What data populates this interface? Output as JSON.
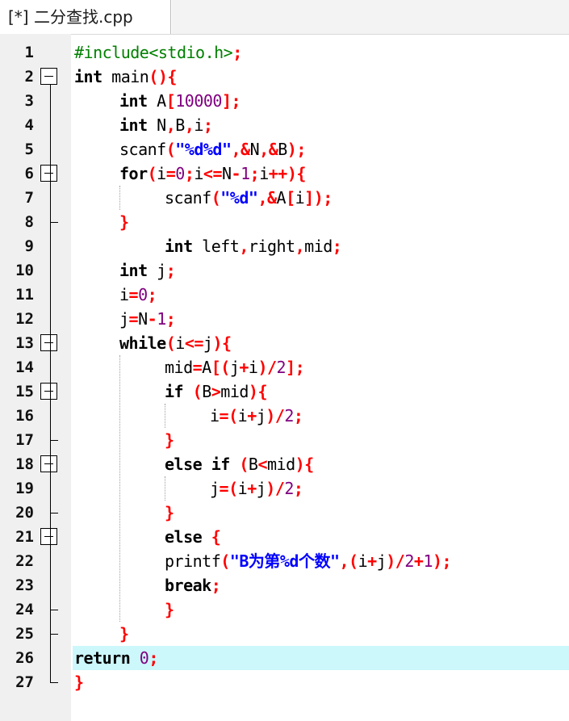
{
  "tab": {
    "title": "[*] 二分查找.cpp"
  },
  "lines": [
    {
      "n": "1",
      "indent": 0,
      "tokens": [
        [
          "pre",
          "#include<stdio.h>"
        ],
        [
          "sym",
          ";"
        ]
      ]
    },
    {
      "n": "2",
      "indent": 0,
      "tokens": [
        [
          "kw",
          "int"
        ],
        [
          "plain",
          " main"
        ],
        [
          "sym",
          "(){"
        ]
      ]
    },
    {
      "n": "3",
      "indent": 1,
      "tokens": [
        [
          "kw",
          "int"
        ],
        [
          "plain",
          " A"
        ],
        [
          "sym",
          "["
        ],
        [
          "num",
          "10000"
        ],
        [
          "sym",
          "];"
        ]
      ]
    },
    {
      "n": "4",
      "indent": 1,
      "tokens": [
        [
          "kw",
          "int"
        ],
        [
          "plain",
          " N"
        ],
        [
          "sym",
          ","
        ],
        [
          "plain",
          "B"
        ],
        [
          "sym",
          ","
        ],
        [
          "plain",
          "i"
        ],
        [
          "sym",
          ";"
        ]
      ]
    },
    {
      "n": "5",
      "indent": 1,
      "tokens": [
        [
          "plain",
          "scanf"
        ],
        [
          "sym",
          "("
        ],
        [
          "str",
          "\"%d%d\""
        ],
        [
          "sym",
          ",&"
        ],
        [
          "plain",
          "N"
        ],
        [
          "sym",
          ",&"
        ],
        [
          "plain",
          "B"
        ],
        [
          "sym",
          ");"
        ]
      ]
    },
    {
      "n": "6",
      "indent": 1,
      "tokens": [
        [
          "kw",
          "for"
        ],
        [
          "sym",
          "("
        ],
        [
          "plain",
          "i"
        ],
        [
          "sym",
          "="
        ],
        [
          "num",
          "0"
        ],
        [
          "sym",
          ";"
        ],
        [
          "plain",
          "i"
        ],
        [
          "sym",
          "<="
        ],
        [
          "plain",
          "N"
        ],
        [
          "sym",
          "-"
        ],
        [
          "num",
          "1"
        ],
        [
          "sym",
          ";"
        ],
        [
          "plain",
          "i"
        ],
        [
          "sym",
          "++){"
        ]
      ]
    },
    {
      "n": "7",
      "indent": 2,
      "tokens": [
        [
          "plain",
          "scanf"
        ],
        [
          "sym",
          "("
        ],
        [
          "str",
          "\"%d\""
        ],
        [
          "sym",
          ",&"
        ],
        [
          "plain",
          "A"
        ],
        [
          "sym",
          "["
        ],
        [
          "plain",
          "i"
        ],
        [
          "sym",
          "]);"
        ]
      ]
    },
    {
      "n": "8",
      "indent": 1,
      "tokens": [
        [
          "sym",
          "}"
        ]
      ]
    },
    {
      "n": "9",
      "indent": 2,
      "tokens": [
        [
          "kw",
          "int"
        ],
        [
          "plain",
          " left"
        ],
        [
          "sym",
          ","
        ],
        [
          "plain",
          "right"
        ],
        [
          "sym",
          ","
        ],
        [
          "plain",
          "mid"
        ],
        [
          "sym",
          ";"
        ]
      ]
    },
    {
      "n": "10",
      "indent": 1,
      "tokens": [
        [
          "kw",
          "int"
        ],
        [
          "plain",
          " j"
        ],
        [
          "sym",
          ";"
        ]
      ]
    },
    {
      "n": "11",
      "indent": 1,
      "tokens": [
        [
          "plain",
          "i"
        ],
        [
          "sym",
          "="
        ],
        [
          "num",
          "0"
        ],
        [
          "sym",
          ";"
        ]
      ]
    },
    {
      "n": "12",
      "indent": 1,
      "tokens": [
        [
          "plain",
          "j"
        ],
        [
          "sym",
          "="
        ],
        [
          "plain",
          "N"
        ],
        [
          "sym",
          "-"
        ],
        [
          "num",
          "1"
        ],
        [
          "sym",
          ";"
        ]
      ]
    },
    {
      "n": "13",
      "indent": 1,
      "tokens": [
        [
          "kw",
          "while"
        ],
        [
          "sym",
          "("
        ],
        [
          "plain",
          "i"
        ],
        [
          "sym",
          "<="
        ],
        [
          "plain",
          "j"
        ],
        [
          "sym",
          "){"
        ]
      ]
    },
    {
      "n": "14",
      "indent": 2,
      "tokens": [
        [
          "plain",
          "mid"
        ],
        [
          "sym",
          "="
        ],
        [
          "plain",
          "A"
        ],
        [
          "sym",
          "[("
        ],
        [
          "plain",
          "j"
        ],
        [
          "sym",
          "+"
        ],
        [
          "plain",
          "i"
        ],
        [
          "sym",
          ")/"
        ],
        [
          "num",
          "2"
        ],
        [
          "sym",
          "];"
        ]
      ]
    },
    {
      "n": "15",
      "indent": 2,
      "tokens": [
        [
          "kw",
          "if"
        ],
        [
          "plain",
          " "
        ],
        [
          "sym",
          "("
        ],
        [
          "plain",
          "B"
        ],
        [
          "sym",
          ">"
        ],
        [
          "plain",
          "mid"
        ],
        [
          "sym",
          "){"
        ]
      ]
    },
    {
      "n": "16",
      "indent": 3,
      "tokens": [
        [
          "plain",
          "i"
        ],
        [
          "sym",
          "=("
        ],
        [
          "plain",
          "i"
        ],
        [
          "sym",
          "+"
        ],
        [
          "plain",
          "j"
        ],
        [
          "sym",
          ")/"
        ],
        [
          "num",
          "2"
        ],
        [
          "sym",
          ";"
        ]
      ]
    },
    {
      "n": "17",
      "indent": 2,
      "tokens": [
        [
          "sym",
          "}"
        ]
      ]
    },
    {
      "n": "18",
      "indent": 2,
      "tokens": [
        [
          "kw",
          "else if"
        ],
        [
          "plain",
          " "
        ],
        [
          "sym",
          "("
        ],
        [
          "plain",
          "B"
        ],
        [
          "sym",
          "<"
        ],
        [
          "plain",
          "mid"
        ],
        [
          "sym",
          "){"
        ]
      ]
    },
    {
      "n": "19",
      "indent": 3,
      "tokens": [
        [
          "plain",
          "j"
        ],
        [
          "sym",
          "=("
        ],
        [
          "plain",
          "i"
        ],
        [
          "sym",
          "+"
        ],
        [
          "plain",
          "j"
        ],
        [
          "sym",
          ")/"
        ],
        [
          "num",
          "2"
        ],
        [
          "sym",
          ";"
        ]
      ]
    },
    {
      "n": "20",
      "indent": 2,
      "tokens": [
        [
          "sym",
          "}"
        ]
      ]
    },
    {
      "n": "21",
      "indent": 2,
      "tokens": [
        [
          "kw",
          "else"
        ],
        [
          "plain",
          " "
        ],
        [
          "sym",
          "{"
        ]
      ]
    },
    {
      "n": "22",
      "indent": 2,
      "tokens": [
        [
          "plain",
          "printf"
        ],
        [
          "sym",
          "("
        ],
        [
          "str",
          "\"B为第%d个数\""
        ],
        [
          "sym",
          ",("
        ],
        [
          "plain",
          "i"
        ],
        [
          "sym",
          "+"
        ],
        [
          "plain",
          "j"
        ],
        [
          "sym",
          ")/"
        ],
        [
          "num",
          "2"
        ],
        [
          "sym",
          "+"
        ],
        [
          "num",
          "1"
        ],
        [
          "sym",
          ");"
        ]
      ]
    },
    {
      "n": "23",
      "indent": 2,
      "tokens": [
        [
          "kw",
          "break"
        ],
        [
          "sym",
          ";"
        ]
      ]
    },
    {
      "n": "24",
      "indent": 2,
      "tokens": [
        [
          "sym",
          "}"
        ]
      ]
    },
    {
      "n": "25",
      "indent": 1,
      "tokens": [
        [
          "sym",
          "}"
        ]
      ]
    },
    {
      "n": "26",
      "indent": 0,
      "highlight": true,
      "tokens": [
        [
          "kw",
          "return"
        ],
        [
          "plain",
          " "
        ],
        [
          "num",
          "0"
        ],
        [
          "sym",
          ";"
        ]
      ]
    },
    {
      "n": "27",
      "indent": 0,
      "tokens": [
        [
          "sym",
          "}"
        ]
      ]
    }
  ],
  "folds": [
    {
      "start": "2",
      "end": "27"
    },
    {
      "start": "6",
      "end": "8"
    },
    {
      "start": "13",
      "end": "25"
    },
    {
      "start": "15",
      "end": "17"
    },
    {
      "start": "18",
      "end": "20"
    },
    {
      "start": "21",
      "end": "24"
    }
  ],
  "colors": {
    "keyword": "#000000",
    "preprocessor": "#008000",
    "symbol": "#ff0000",
    "number": "#800080",
    "string": "#0000ff",
    "current_line": "#ccf7fb"
  }
}
